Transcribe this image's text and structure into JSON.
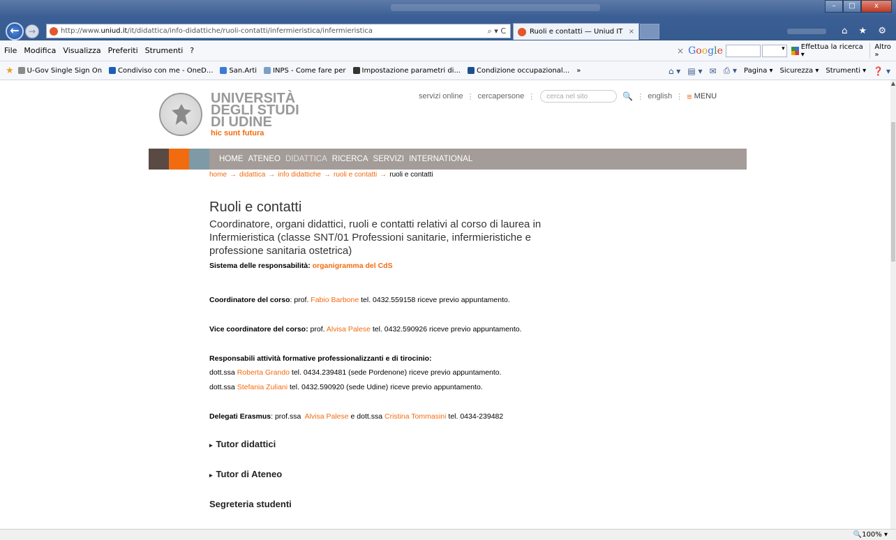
{
  "browser": {
    "url_prefix": "http://www.",
    "url_domain": "uniud.it",
    "url_path": "/it/didattica/info-didattiche/ruoli-contatti/infermieristica/infermieristica",
    "url_controls": "⌕ ▾ C",
    "tab_title": "Ruoli e contatti — Uniud IT",
    "tab_close": "×",
    "window_buttons": {
      "minimize": "–",
      "maximize": "□",
      "close": "x"
    },
    "top_icons": "⌂ ★ ⚙",
    "menu": [
      "File",
      "Modifica",
      "Visualizza",
      "Preferiti",
      "Strumenti",
      "?"
    ],
    "google": {
      "close": "×",
      "logo": [
        "G",
        "o",
        "o",
        "g",
        "l",
        "e"
      ],
      "dropdown": "▾",
      "search_label": "Effettua la ricerca ▾",
      "more": "Altro »"
    },
    "favorites": [
      {
        "label": "U-Gov Single Sign On",
        "color": "#8a8a8a"
      },
      {
        "label": "Condiviso con me - OneD...",
        "color": "#1c5fb8"
      },
      {
        "label": "San.Arti",
        "color": "#3a7bd5"
      },
      {
        "label": "INPS - Come fare per",
        "color": "#7aa0c8"
      },
      {
        "label": "Impostazione parametri di...",
        "color": "#333333"
      },
      {
        "label": "Condizione occupazional...",
        "color": "#1f4e8f"
      }
    ],
    "fav_overflow": "»",
    "commands": [
      "⌂ ▾",
      "▤ ▾",
      "✉",
      "⎙ ▾",
      "Pagina ▾",
      "Sicurezza ▾",
      "Strumenti ▾",
      "❓ ▾"
    ],
    "zoom": "🔍100%  ▾"
  },
  "site": {
    "wordmark": [
      "UNIVERSITÀ",
      "DEGLI STUDI",
      "DI UDINE"
    ],
    "motto": "hic sunt futura",
    "top_links": {
      "servizi": "servizi online",
      "cercapersone": "cercapersone",
      "search_placeholder": "cerca nel sito",
      "search_icon": "🔍",
      "english": "english",
      "menu": "MENU",
      "hamburger": "≡"
    },
    "nav_colors": [
      "#5a4a44",
      "#f26b0f",
      "#7e9aa6"
    ],
    "nav": [
      "HOME",
      "ATENEO",
      "DIDATTICA",
      "RICERCA",
      "SERVIZI",
      "INTERNATIONAL"
    ],
    "breadcrumb": [
      "home",
      "didattica",
      "info didattiche",
      "ruoli e contatti"
    ],
    "breadcrumb_current": "ruoli e contatti",
    "arrow": "→"
  },
  "content": {
    "title": "Ruoli e contatti",
    "subtitle": "Coordinatore, organi didattici, ruoli e contatti relativi al corso di laurea in Infermieristica (classe SNT/01 Professioni sanitarie, infermieristiche e professione sanitaria ostetrica)",
    "sistema_label": "Sistema delle responsabilità:",
    "sistema_link": "organigramma del CdS",
    "coord_label": "Coordinatore del corso",
    "coord_pre": ": prof.",
    "coord_name": "Fabio Barbone",
    "coord_post": "tel. 0432.559158 riceve previo appuntamento.",
    "vice_label": "Vice coordinatore del corso:",
    "vice_pre": "prof.",
    "vice_name": "Alvisa Palese",
    "vice_post": "tel. 0432.590926 riceve previo appuntamento.",
    "resp_label": "Responsabili attività formative professionalizzanti e di tirocinio:",
    "resp": [
      {
        "pre": "dott.ssa",
        "name": "Roberta Grando",
        "post": "tel. 0434.239481 (sede Pordenone) riceve previo appuntamento."
      },
      {
        "pre": "dott.ssa",
        "name": "Stefania Zuliani",
        "post": "tel. 0432.590920 (sede Udine) riceve previo appuntamento."
      }
    ],
    "eras_label": "Delegati Erasmus",
    "eras_pre": ": prof.ssa",
    "eras_name1": "Alvisa Palese",
    "eras_mid": "e dott.ssa",
    "eras_name2": "Cristina Tommasini",
    "eras_post": "tel. 0434-239482",
    "sections": [
      "Tutor didattici",
      "Tutor di Ateneo"
    ],
    "section_marker": "▸",
    "segreteria": "Segreteria studenti"
  }
}
